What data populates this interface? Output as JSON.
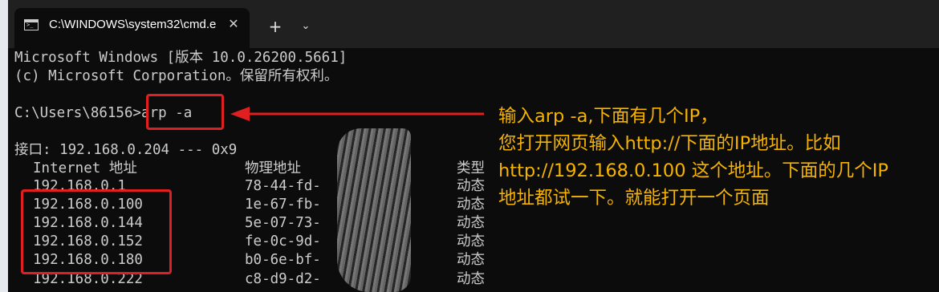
{
  "tab": {
    "title": "C:\\WINDOWS\\system32\\cmd.e",
    "icon": "terminal-icon",
    "close_glyph": "✕",
    "new_tab_glyph": "+",
    "dropdown_glyph": "⌄"
  },
  "terminal": {
    "header_line1": "Microsoft Windows [版本 10.0.26200.5661]",
    "header_line2": "(c) Microsoft Corporation。保留所有权利。",
    "prompt": "C:\\Users\\86156>",
    "command": "arp -a",
    "interface_line": "接口: 192.168.0.204 --- 0x9",
    "col_internet": "Internet 地址",
    "col_physical": "物理地址",
    "col_type": "类型",
    "rows": [
      {
        "ip": "192.168.0.1",
        "mac": "78-44-fd-",
        "type": "动态"
      },
      {
        "ip": "192.168.0.100",
        "mac": "1e-67-fb-",
        "type": "动态"
      },
      {
        "ip": "192.168.0.144",
        "mac": "5e-07-73-",
        "type": "动态"
      },
      {
        "ip": "192.168.0.152",
        "mac": "fe-0c-9d-",
        "type": "动态"
      },
      {
        "ip": "192.168.0.180",
        "mac": "b0-6e-bf-",
        "type": "动态"
      },
      {
        "ip": "192.168.0.222",
        "mac": "c8-d9-d2-",
        "type": "动态"
      }
    ]
  },
  "annotation": {
    "line1": "输入arp -a,下面有几个IP，",
    "line2": "您打开网页输入http://下面的IP地址。比如",
    "line3": "http://192.168.0.100 这个地址。下面的几个IP",
    "line4": "地址都试一下。就能打开一个页面",
    "color": "#f5b300"
  },
  "colors": {
    "highlight": "#e02020",
    "terminal_bg": "#0c0c0c",
    "terminal_text": "#cccccc"
  }
}
